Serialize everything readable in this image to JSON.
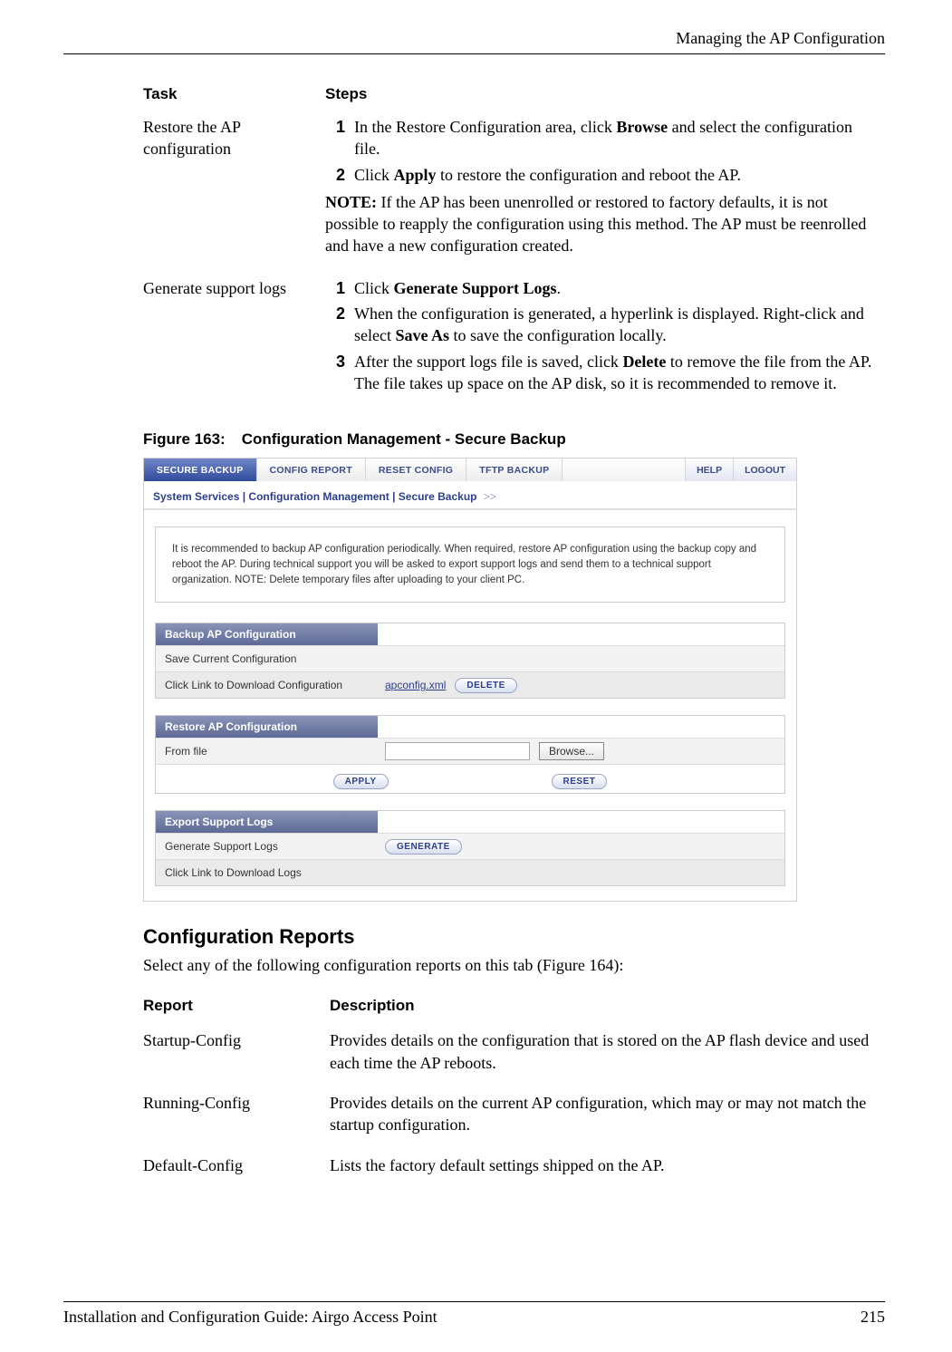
{
  "header": {
    "title": "Managing the AP Configuration"
  },
  "taskTable": {
    "head": {
      "task": "Task",
      "steps": "Steps"
    },
    "rows": [
      {
        "task": "Restore the AP configuration",
        "steps": [
          {
            "n": "1",
            "pre": "In the Restore Configuration area, click ",
            "bold": "Browse",
            "post": " and select the configuration file."
          },
          {
            "n": "2",
            "pre": "Click ",
            "bold": "Apply",
            "post": " to restore the configuration and reboot the AP."
          }
        ],
        "noteLabel": "NOTE:",
        "noteText": " If the AP has been unenrolled or restored to factory defaults, it is not possible to reapply the configuration using this method. The AP must be reenrolled and have a new configuration created."
      },
      {
        "task": "Generate support logs",
        "steps": [
          {
            "n": "1",
            "pre": "Click ",
            "bold": "Generate Support Logs",
            "post": "."
          },
          {
            "n": "2",
            "pre": "When the configuration is generated, a hyperlink is displayed. Right-click and select ",
            "bold": "Save As",
            "post": " to save the configuration locally."
          },
          {
            "n": "3",
            "pre": "After the support logs file is saved, click ",
            "bold": "Delete",
            "post": " to remove the file from the AP. The file takes up space on the AP disk, so it is recommended to remove it."
          }
        ]
      }
    ]
  },
  "figure": {
    "num": "Figure 163:",
    "title": "Configuration Management - Secure Backup"
  },
  "screenshot": {
    "tabs": [
      "SECURE BACKUP",
      "CONFIG REPORT",
      "RESET CONFIG",
      "TFTP BACKUP"
    ],
    "help": "HELP",
    "logout": "LOGOUT",
    "breadcrumb": "System Services | Configuration Management | Secure Backup",
    "arrows": ">>",
    "info": "It is recommended to backup AP configuration periodically. When required, restore AP configuration using the backup copy and reboot the AP. During technical support you will be asked to export support logs and send them to a technical support organization. NOTE: Delete temporary files after uploading to your client PC.",
    "backup": {
      "head": "Backup AP Configuration",
      "row1": "Save Current Configuration",
      "row2": "Click Link to Download Configuration",
      "link": "apconfig.xml",
      "deleteBtn": "DELETE"
    },
    "restore": {
      "head": "Restore AP Configuration",
      "row1": "From file",
      "browse": "Browse...",
      "apply": "APPLY",
      "reset": "RESET"
    },
    "export": {
      "head": "Export Support Logs",
      "row1": "Generate Support Logs",
      "generate": "GENERATE",
      "row2": "Click Link to Download Logs"
    }
  },
  "section": {
    "title": "Configuration Reports",
    "intro": "Select any of the following configuration reports on this tab (Figure 164):"
  },
  "reportTable": {
    "head": {
      "report": "Report",
      "desc": "Description"
    },
    "rows": [
      {
        "name": "Startup-Config",
        "desc": "Provides details on the configuration that is stored on the AP flash device and used each time the AP reboots."
      },
      {
        "name": "Running-Config",
        "desc": "Provides details on the current AP configuration, which may or may not match the startup configuration."
      },
      {
        "name": "Default-Config",
        "desc": "Lists the factory default settings shipped on the AP."
      }
    ]
  },
  "footer": {
    "left": "Installation and Configuration Guide: Airgo Access Point",
    "right": "215"
  }
}
